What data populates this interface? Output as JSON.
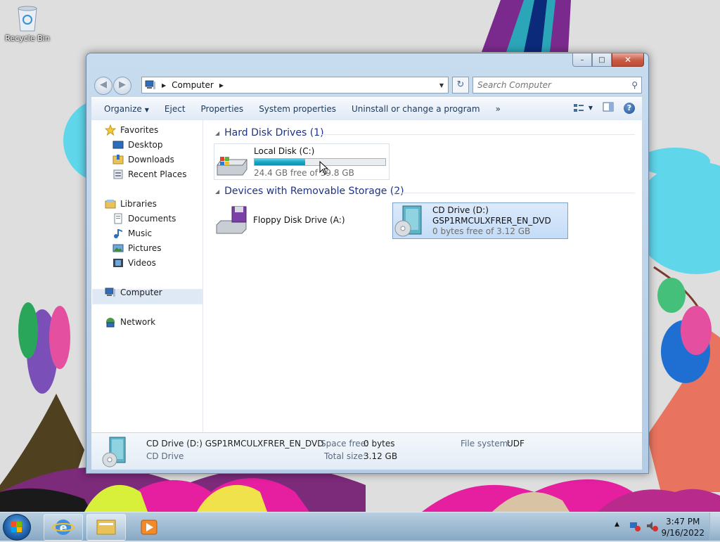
{
  "desktop": {
    "recycle_bin_label": "Recycle Bin"
  },
  "window": {
    "caption_buttons": {
      "minimize": "–",
      "maximize": "□",
      "close": "✕"
    },
    "address": {
      "icon": "computer-icon",
      "path": "Computer",
      "separator": "▶"
    },
    "search": {
      "placeholder": "Search Computer",
      "icon": "search-icon"
    },
    "toolbar": {
      "organize": "Organize",
      "eject": "Eject",
      "properties": "Properties",
      "system_properties": "System properties",
      "uninstall": "Uninstall or change a program",
      "more": "»"
    },
    "navpane": {
      "favorites": "Favorites",
      "desktop": "Desktop",
      "downloads": "Downloads",
      "recent_places": "Recent Places",
      "libraries": "Libraries",
      "documents": "Documents",
      "music": "Music",
      "pictures": "Pictures",
      "videos": "Videos",
      "computer": "Computer",
      "network": "Network"
    },
    "groups": {
      "hard_disks": "Hard Disk Drives (1)",
      "removable": "Devices with Removable Storage (2)"
    },
    "drives": {
      "local_disk": {
        "name": "Local Disk (C:)",
        "free": "24.4 GB free of 39.8 GB",
        "used_fraction": 0.387
      },
      "floppy": {
        "name": "Floppy Disk Drive (A:)"
      },
      "cd": {
        "name": "CD Drive (D:)",
        "label": "GSP1RMCULXFRER_EN_DVD",
        "free": "0 bytes free of 3.12 GB"
      }
    },
    "details": {
      "title": "CD Drive (D:) GSP1RMCULXFRER_EN_DVD",
      "type": "CD Drive",
      "space_free_label": "Space free:",
      "space_free_value": "0 bytes",
      "total_size_label": "Total size:",
      "total_size_value": "3.12 GB",
      "filesystem_label": "File system:",
      "filesystem_value": "UDF"
    }
  },
  "taskbar": {
    "clock_time": "3:47 PM",
    "clock_date": "9/16/2022",
    "tray_arrow": "▲"
  },
  "colors": {
    "group_header": "#1e3287",
    "selection": "#c4dcf8",
    "progress": "#1aa5c6"
  }
}
